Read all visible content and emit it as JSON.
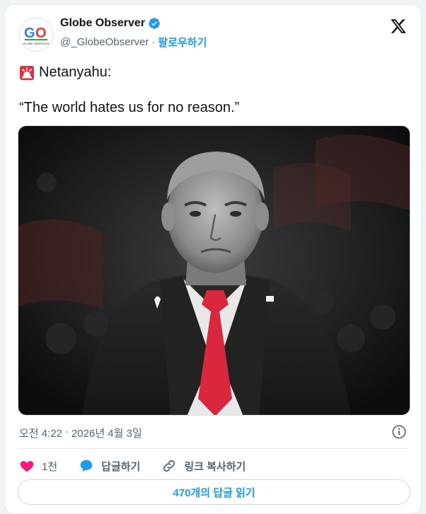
{
  "account": {
    "display_name": "Globe Observer",
    "handle": "@_GlobeObserver",
    "separator": "·",
    "follow_label": "팔로우하기",
    "avatar_text": "GO",
    "avatar_subtext": "GLOBE OBSERVER",
    "verified_icon": "verified-badge-icon"
  },
  "post": {
    "emoji_icon": "police-siren-icon",
    "line1": "Netanyahu:",
    "quote": "“The world hates us for no reason.”",
    "image_description_icon": "portrait-photo",
    "time": "오전 4:22",
    "date_separator": "·",
    "date": "2026년 4월 3일"
  },
  "actions": {
    "like_count": "1천",
    "reply_label": "답글하기",
    "copy_link_label": "링크 복사하기"
  },
  "read_replies_label": "470개의 답글 읽기",
  "colors": {
    "accent": "#1d9bf0",
    "like": "#f91880",
    "tie_red": "#d9283e",
    "text": "#0f1419",
    "secondary": "#536471"
  }
}
